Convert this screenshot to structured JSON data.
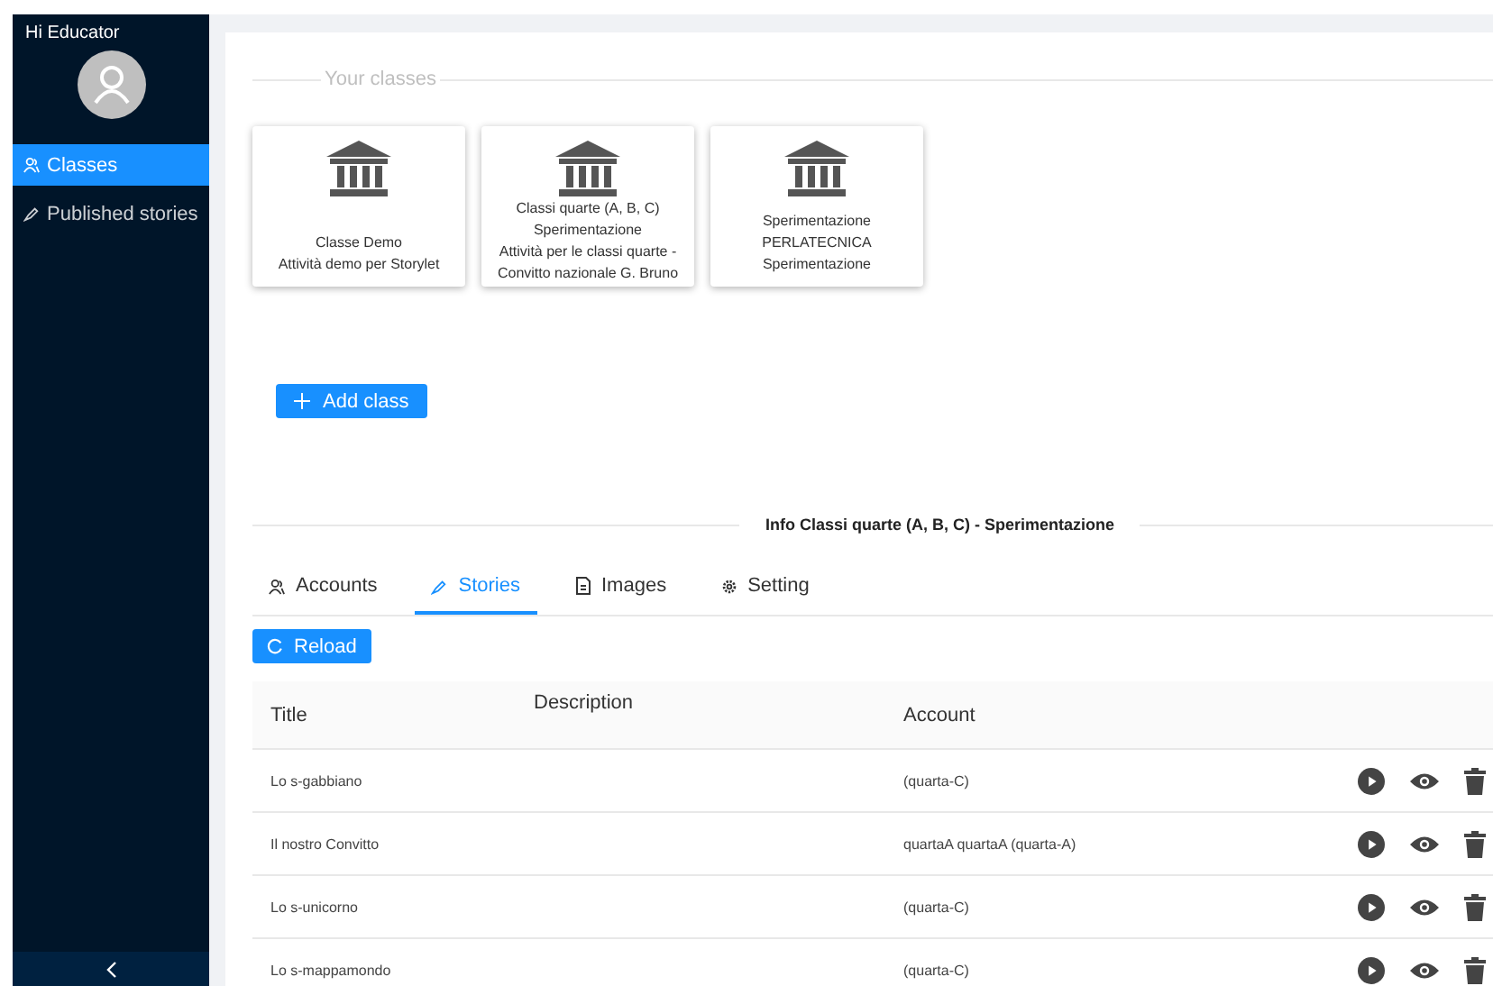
{
  "sidebar": {
    "greeting": "Hi Educator",
    "items": [
      {
        "label": "Classes",
        "selected": true
      },
      {
        "label": "Published stories",
        "selected": false
      }
    ]
  },
  "classes_section": {
    "title": "Your classes",
    "cards": [
      {
        "lines": [
          "Classe Demo",
          "Attività demo per Storylet"
        ]
      },
      {
        "lines": [
          "Classi quarte (A, B, C)",
          "Sperimentazione",
          "Attività per le classi quarte -",
          "Convitto nazionale G. Bruno"
        ]
      },
      {
        "lines": [
          "Sperimentazione",
          "PERLATECNICA",
          "Sperimentazione"
        ]
      }
    ],
    "add_button": "Add class"
  },
  "info": {
    "title": "Info Classi quarte (A, B, C) - Sperimentazione",
    "tabs": [
      {
        "label": "Accounts",
        "selected": false
      },
      {
        "label": "Stories",
        "selected": true
      },
      {
        "label": "Images",
        "selected": false
      },
      {
        "label": "Setting",
        "selected": false
      }
    ],
    "reload_button": "Reload",
    "table": {
      "columns": [
        "Title",
        "Description",
        "Account"
      ],
      "rows": [
        {
          "title": "Lo s-gabbiano",
          "account": "(quarta-C)"
        },
        {
          "title": "Il nostro Convitto",
          "account": "quartaA quartaA (quarta-A)"
        },
        {
          "title": "Lo s-unicorno",
          "account": "(quarta-C)"
        },
        {
          "title": "Lo s-mappamondo",
          "account": "(quarta-C)"
        }
      ]
    }
  }
}
